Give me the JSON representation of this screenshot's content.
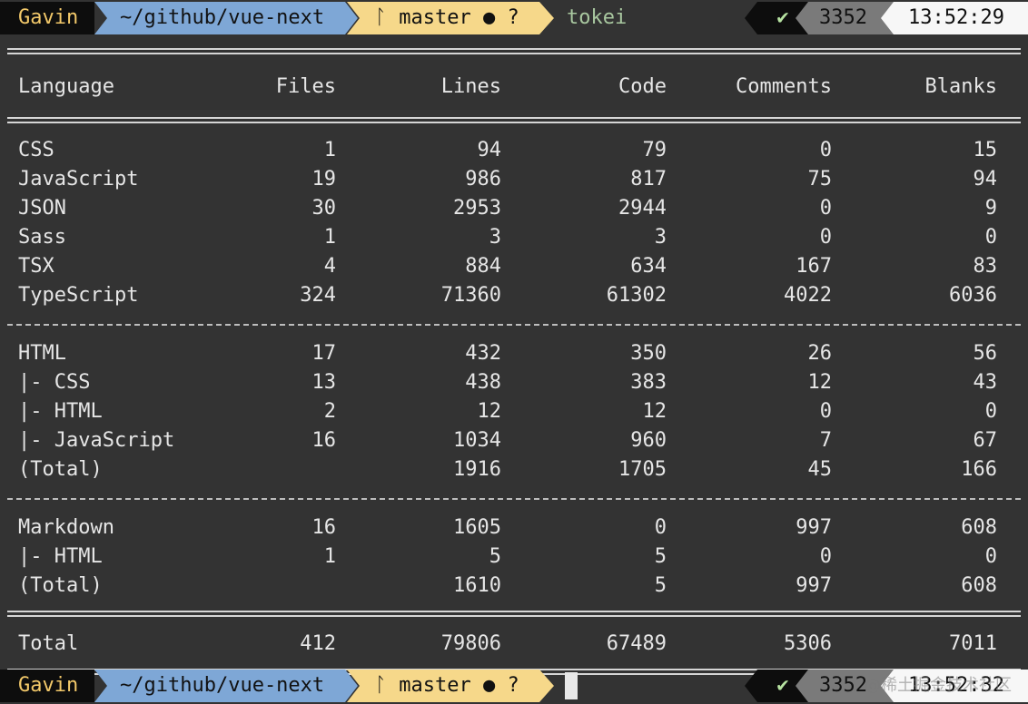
{
  "prompt_top": {
    "user": "Gavin",
    "dir": "~/github/vue-next",
    "git": "master ● ?",
    "command": "tokei",
    "status": "✔",
    "jobs": "3352",
    "time": "13:52:29"
  },
  "prompt_bottom": {
    "user": "Gavin",
    "dir": "~/github/vue-next",
    "git": "master ● ?",
    "status": "✔",
    "jobs": "3352",
    "time": "13:52:32",
    "watermark": "@稀土掘金技术社区"
  },
  "table": {
    "columns": [
      "Language",
      "Files",
      "Lines",
      "Code",
      "Comments",
      "Blanks"
    ],
    "group1": [
      [
        "CSS",
        "1",
        "94",
        "79",
        "0",
        "15"
      ],
      [
        "JavaScript",
        "19",
        "986",
        "817",
        "75",
        "94"
      ],
      [
        "JSON",
        "30",
        "2953",
        "2944",
        "0",
        "9"
      ],
      [
        "Sass",
        "1",
        "3",
        "3",
        "0",
        "0"
      ],
      [
        "TSX",
        "4",
        "884",
        "634",
        "167",
        "83"
      ],
      [
        "TypeScript",
        "324",
        "71360",
        "61302",
        "4022",
        "6036"
      ]
    ],
    "group2": [
      [
        "HTML",
        "17",
        "432",
        "350",
        "26",
        "56"
      ],
      [
        "|- CSS",
        "13",
        "438",
        "383",
        "12",
        "43"
      ],
      [
        "|- HTML",
        "2",
        "12",
        "12",
        "0",
        "0"
      ],
      [
        "|- JavaScript",
        "16",
        "1034",
        "960",
        "7",
        "67"
      ],
      [
        "(Total)",
        "",
        "1916",
        "1705",
        "45",
        "166"
      ]
    ],
    "group3": [
      [
        "Markdown",
        "16",
        "1605",
        "0",
        "997",
        "608"
      ],
      [
        "|- HTML",
        "1",
        "5",
        "5",
        "0",
        "0"
      ],
      [
        "(Total)",
        "",
        "1610",
        "5",
        "997",
        "608"
      ]
    ],
    "total": [
      "Total",
      "412",
      "79806",
      "67489",
      "5306",
      "7011"
    ]
  }
}
